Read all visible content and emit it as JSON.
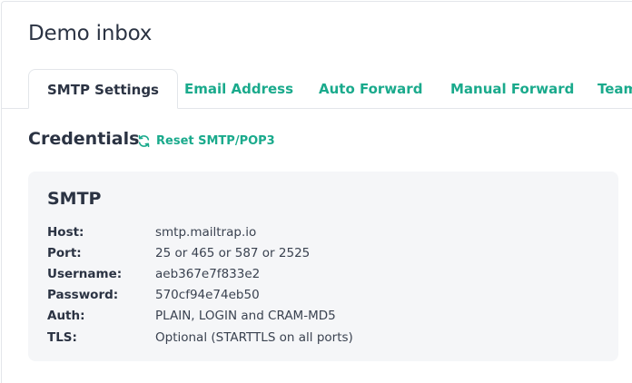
{
  "inbox": {
    "title": "Demo inbox"
  },
  "tabs": [
    {
      "label": "SMTP Settings",
      "active": true
    },
    {
      "label": "Email Address",
      "active": false
    },
    {
      "label": "Auto Forward",
      "active": false
    },
    {
      "label": "Manual Forward",
      "active": false
    },
    {
      "label": "Team",
      "active": false
    }
  ],
  "credentials": {
    "title": "Credentials",
    "reset_label": "Reset SMTP/POP3",
    "reset_icon": "refresh-icon"
  },
  "smtp": {
    "title": "SMTP",
    "rows": [
      {
        "key": "Host:",
        "value": "smtp.mailtrap.io"
      },
      {
        "key": "Port:",
        "value": "25 or 465 or 587 or 2525"
      },
      {
        "key": "Username:",
        "value": "aeb367e7f833e2"
      },
      {
        "key": "Password:",
        "value": "570cf94e74eb50"
      },
      {
        "key": "Auth:",
        "value": "PLAIN, LOGIN and CRAM-MD5"
      },
      {
        "key": "TLS:",
        "value": "Optional (STARTTLS on all ports)"
      }
    ]
  },
  "colors": {
    "accent": "#1aaa8c",
    "text": "#2b3343",
    "card_bg": "#f5f6f8",
    "border": "#e3e6ea"
  }
}
